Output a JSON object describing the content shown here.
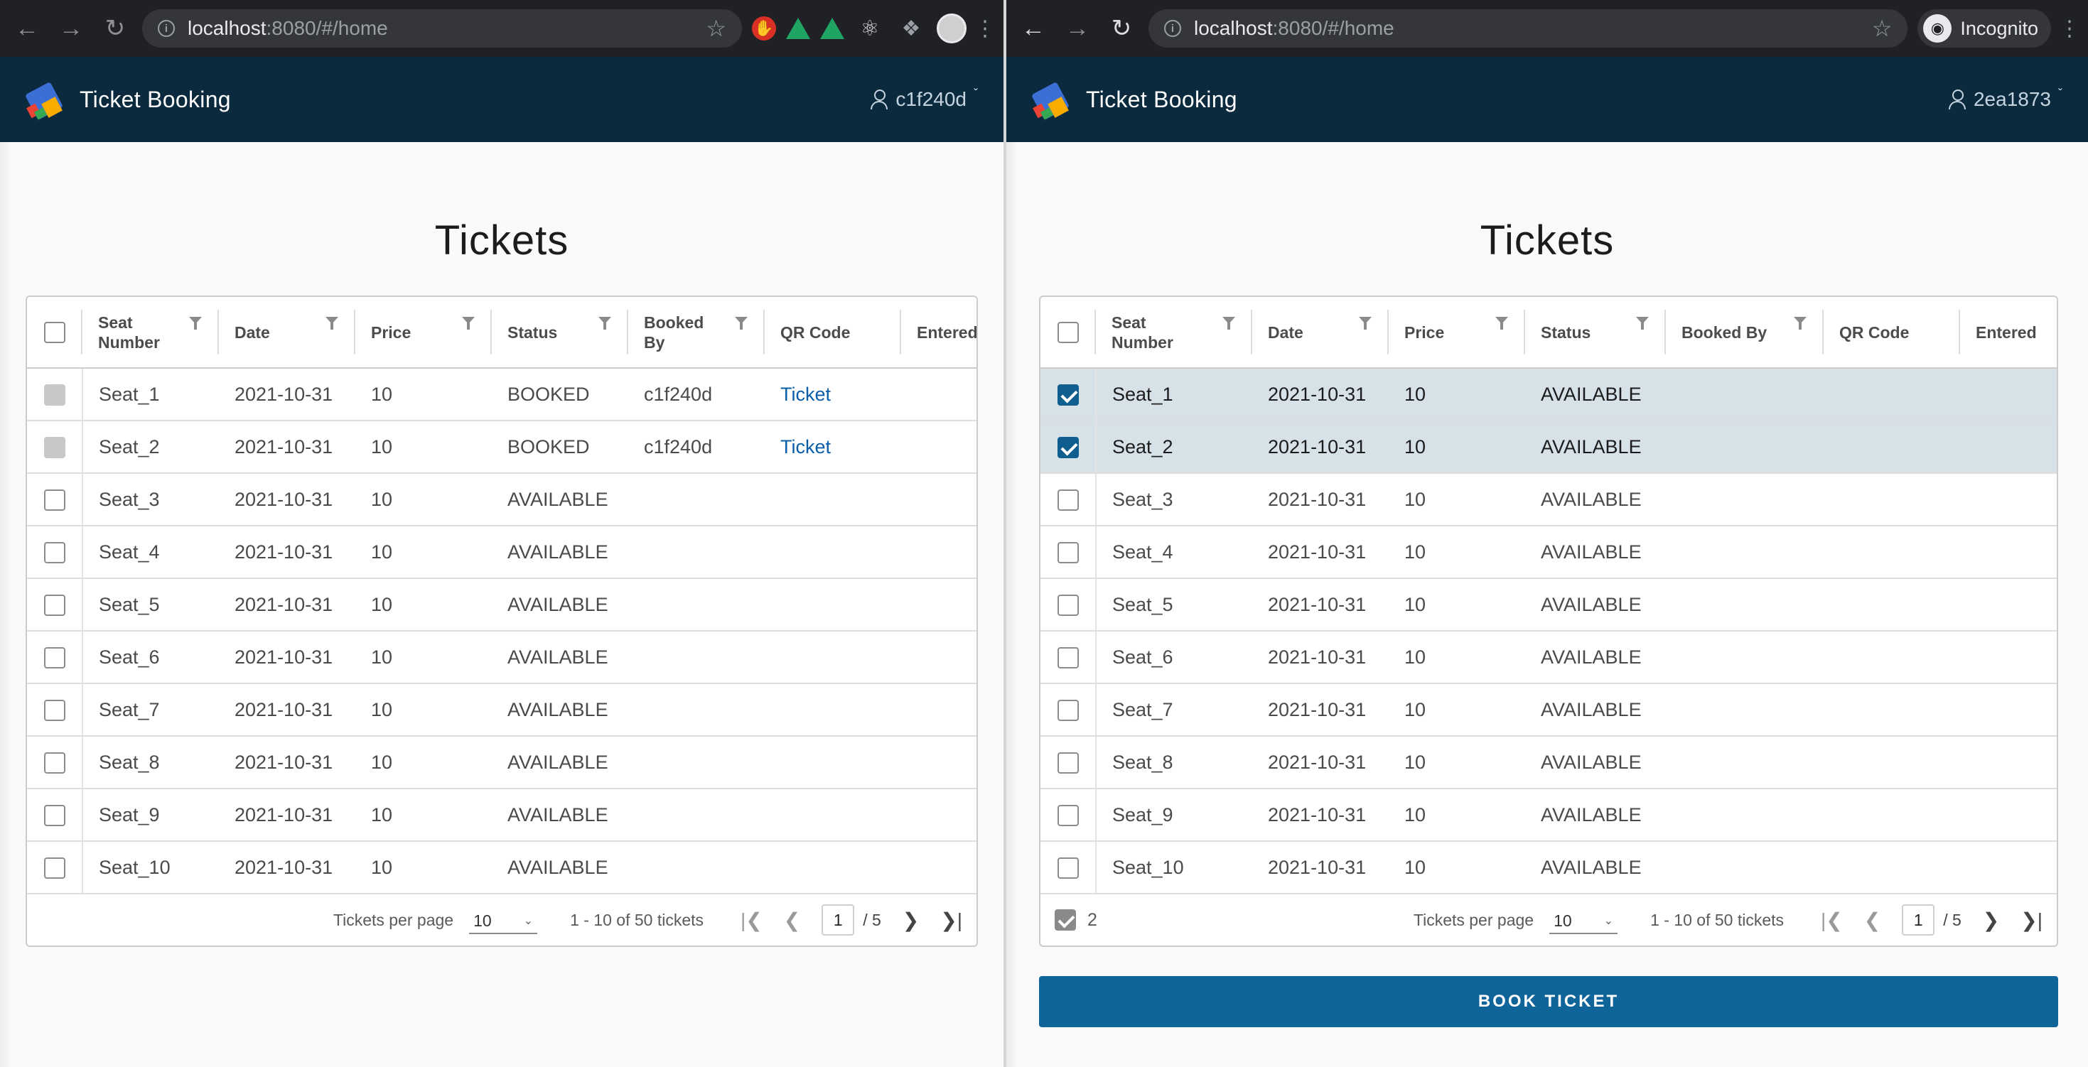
{
  "left": {
    "browser": {
      "url_host": "localhost",
      "url_rest": ":8080/#/home"
    },
    "app": {
      "title": "Ticket Booking",
      "user": "c1f240d"
    },
    "page_title": "Tickets",
    "columns": [
      "Seat Number",
      "Date",
      "Price",
      "Status",
      "Booked By",
      "QR Code",
      "Entered"
    ],
    "rows": [
      {
        "seat": "Seat_1",
        "date": "2021-10-31",
        "price": "10",
        "status": "BOOKED",
        "booked_by": "c1f240d",
        "qr": "Ticket",
        "checkbox": "disabled"
      },
      {
        "seat": "Seat_2",
        "date": "2021-10-31",
        "price": "10",
        "status": "BOOKED",
        "booked_by": "c1f240d",
        "qr": "Ticket",
        "checkbox": "disabled"
      },
      {
        "seat": "Seat_3",
        "date": "2021-10-31",
        "price": "10",
        "status": "AVAILABLE",
        "booked_by": "",
        "qr": "",
        "checkbox": "unchecked"
      },
      {
        "seat": "Seat_4",
        "date": "2021-10-31",
        "price": "10",
        "status": "AVAILABLE",
        "booked_by": "",
        "qr": "",
        "checkbox": "unchecked"
      },
      {
        "seat": "Seat_5",
        "date": "2021-10-31",
        "price": "10",
        "status": "AVAILABLE",
        "booked_by": "",
        "qr": "",
        "checkbox": "unchecked"
      },
      {
        "seat": "Seat_6",
        "date": "2021-10-31",
        "price": "10",
        "status": "AVAILABLE",
        "booked_by": "",
        "qr": "",
        "checkbox": "unchecked"
      },
      {
        "seat": "Seat_7",
        "date": "2021-10-31",
        "price": "10",
        "status": "AVAILABLE",
        "booked_by": "",
        "qr": "",
        "checkbox": "unchecked"
      },
      {
        "seat": "Seat_8",
        "date": "2021-10-31",
        "price": "10",
        "status": "AVAILABLE",
        "booked_by": "",
        "qr": "",
        "checkbox": "unchecked"
      },
      {
        "seat": "Seat_9",
        "date": "2021-10-31",
        "price": "10",
        "status": "AVAILABLE",
        "booked_by": "",
        "qr": "",
        "checkbox": "unchecked"
      },
      {
        "seat": "Seat_10",
        "date": "2021-10-31",
        "price": "10",
        "status": "AVAILABLE",
        "booked_by": "",
        "qr": "",
        "checkbox": "unchecked"
      }
    ],
    "footer": {
      "per_page_label": "Tickets per page",
      "per_page_value": "10",
      "range": "1 - 10 of 50 tickets",
      "page": "1",
      "page_total": "/ 5"
    }
  },
  "right": {
    "browser": {
      "url_host": "localhost",
      "url_rest": ":8080/#/home",
      "incognito_label": "Incognito"
    },
    "app": {
      "title": "Ticket Booking",
      "user": "2ea1873"
    },
    "page_title": "Tickets",
    "columns": [
      "Seat Number",
      "Date",
      "Price",
      "Status",
      "Booked By",
      "QR Code",
      "Entered"
    ],
    "rows": [
      {
        "seat": "Seat_1",
        "date": "2021-10-31",
        "price": "10",
        "status": "AVAILABLE",
        "checkbox": "checked"
      },
      {
        "seat": "Seat_2",
        "date": "2021-10-31",
        "price": "10",
        "status": "AVAILABLE",
        "checkbox": "checked"
      },
      {
        "seat": "Seat_3",
        "date": "2021-10-31",
        "price": "10",
        "status": "AVAILABLE",
        "checkbox": "unchecked"
      },
      {
        "seat": "Seat_4",
        "date": "2021-10-31",
        "price": "10",
        "status": "AVAILABLE",
        "checkbox": "unchecked"
      },
      {
        "seat": "Seat_5",
        "date": "2021-10-31",
        "price": "10",
        "status": "AVAILABLE",
        "checkbox": "unchecked"
      },
      {
        "seat": "Seat_6",
        "date": "2021-10-31",
        "price": "10",
        "status": "AVAILABLE",
        "checkbox": "unchecked"
      },
      {
        "seat": "Seat_7",
        "date": "2021-10-31",
        "price": "10",
        "status": "AVAILABLE",
        "checkbox": "unchecked"
      },
      {
        "seat": "Seat_8",
        "date": "2021-10-31",
        "price": "10",
        "status": "AVAILABLE",
        "checkbox": "unchecked"
      },
      {
        "seat": "Seat_9",
        "date": "2021-10-31",
        "price": "10",
        "status": "AVAILABLE",
        "checkbox": "unchecked"
      },
      {
        "seat": "Seat_10",
        "date": "2021-10-31",
        "price": "10",
        "status": "AVAILABLE",
        "checkbox": "unchecked"
      }
    ],
    "footer": {
      "selected_count": "2",
      "per_page_label": "Tickets per page",
      "per_page_value": "10",
      "range": "1 - 10 of 50 tickets",
      "page": "1",
      "page_total": "/ 5"
    },
    "book_button_label": "BOOK TICKET"
  },
  "colors": {
    "header_bg": "#0b2a3e",
    "selected_row_bg": "#d6e1e8",
    "primary_button": "#0f6499",
    "link": "#0a5ea8"
  },
  "icons": {
    "back": "arrow-left-icon",
    "forward": "arrow-right-icon",
    "reload": "reload-icon",
    "site_info": "info-icon",
    "bookmark": "star-icon",
    "filter": "filter-icon",
    "user": "person-icon",
    "pager_first": "first-page-icon",
    "pager_prev": "prev-page-icon",
    "pager_next": "next-page-icon",
    "pager_last": "last-page-icon"
  }
}
